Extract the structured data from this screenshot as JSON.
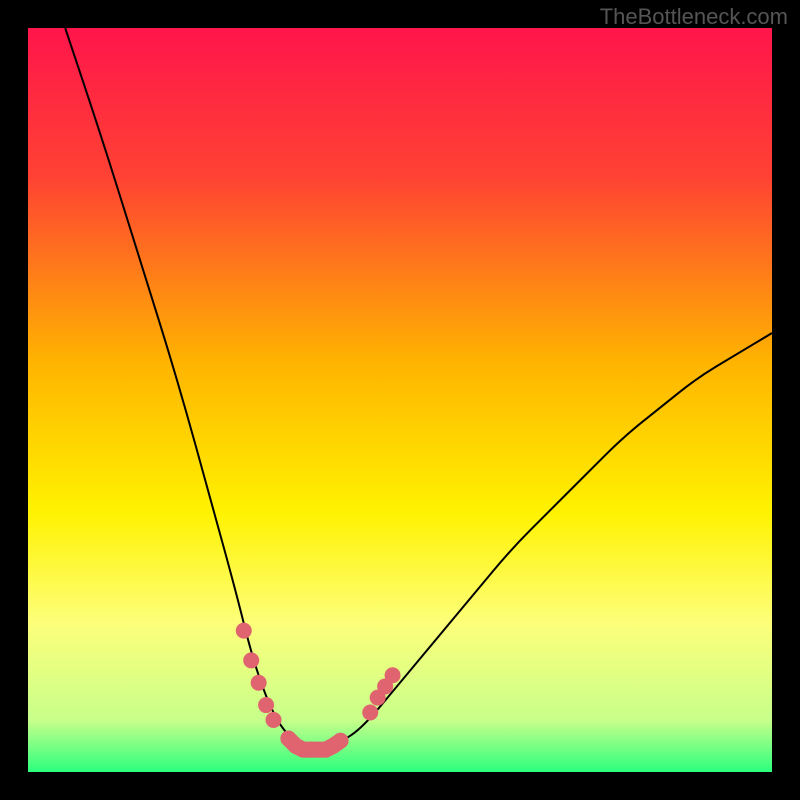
{
  "watermark": "TheBottleneck.com",
  "chart_data": {
    "type": "line",
    "title": "",
    "xlabel": "",
    "ylabel": "",
    "xlim": [
      0,
      100
    ],
    "ylim": [
      0,
      100
    ],
    "gradient_stops": [
      {
        "offset": 0.0,
        "color": "#ff154b"
      },
      {
        "offset": 0.2,
        "color": "#ff4233"
      },
      {
        "offset": 0.45,
        "color": "#ffb400"
      },
      {
        "offset": 0.65,
        "color": "#fff200"
      },
      {
        "offset": 0.8,
        "color": "#fdff7a"
      },
      {
        "offset": 0.93,
        "color": "#c8ff8a"
      },
      {
        "offset": 1.0,
        "color": "#2bff7e"
      }
    ],
    "series": [
      {
        "name": "bottleneck-curve",
        "x": [
          5,
          10,
          15,
          20,
          25,
          28,
          30,
          32,
          34,
          36,
          38,
          40,
          42,
          45,
          50,
          55,
          60,
          65,
          70,
          75,
          80,
          85,
          90,
          95,
          100
        ],
        "y": [
          100,
          85,
          69,
          53,
          35,
          24,
          16,
          10,
          6,
          4,
          3,
          3,
          4,
          6,
          12,
          18,
          24,
          30,
          35,
          40,
          45,
          49,
          53,
          56,
          59
        ]
      }
    ],
    "highlight_segments": [
      {
        "name": "left-tail",
        "x": [
          29,
          30,
          31,
          32,
          33
        ],
        "y": [
          19,
          15,
          12,
          9,
          7
        ]
      },
      {
        "name": "valley",
        "x": [
          35,
          36,
          37,
          38,
          39,
          40,
          41,
          42
        ],
        "y": [
          4.5,
          3.5,
          3,
          3,
          3,
          3,
          3.5,
          4.2
        ]
      },
      {
        "name": "right-tail",
        "x": [
          46,
          47,
          48,
          49
        ],
        "y": [
          8,
          10,
          11.5,
          13
        ]
      }
    ],
    "highlight_color": "#e06370",
    "curve_color": "#000000"
  }
}
